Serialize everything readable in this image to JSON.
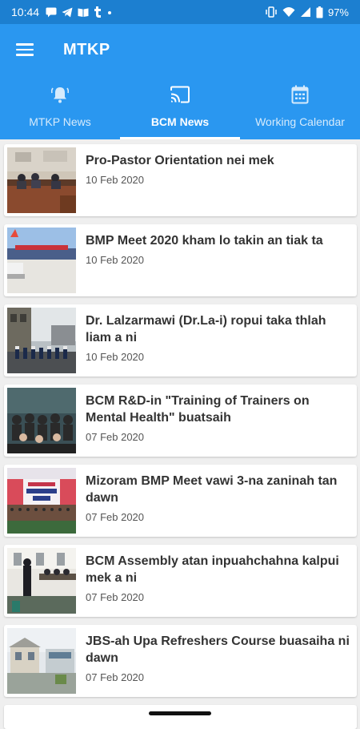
{
  "status_bar": {
    "time": "10:44",
    "battery": "97%",
    "left_icons": [
      "messages-icon",
      "telegram-icon",
      "book-icon",
      "t-app-icon",
      "dot-icon"
    ],
    "right_icons": [
      "vibrate-icon",
      "wifi-icon",
      "signal-icon",
      "battery-icon"
    ]
  },
  "app_bar": {
    "title": "MTKP",
    "menu_icon": "menu-icon",
    "background": "#2a97f0"
  },
  "tabs": [
    {
      "label": "MTKP News",
      "icon": "bell-icon",
      "active": false
    },
    {
      "label": "BCM News",
      "icon": "cast-icon",
      "active": true
    },
    {
      "label": "Working Calendar",
      "icon": "calendar-icon",
      "active": false
    }
  ],
  "news": [
    {
      "title": "Pro-Pastor Orientation nei mek",
      "date": "10 Feb 2020"
    },
    {
      "title": "BMP Meet 2020 kham lo takin an tiak ta",
      "date": "10 Feb 2020"
    },
    {
      "title": "Dr. Lalzarmawi (Dr.La-i) ropui taka thlah liam a ni",
      "date": "10 Feb 2020"
    },
    {
      "title": "BCM R&D-in \"Training of Trainers on Mental Health\" buatsaih",
      "date": "07 Feb 2020"
    },
    {
      "title": "Mizoram BMP Meet vawi 3-na zaninah tan dawn",
      "date": "07 Feb 2020"
    },
    {
      "title": "BCM Assembly atan inpuahchahna kalpui mek a ni",
      "date": "07 Feb 2020"
    },
    {
      "title": "JBS-ah Upa Refreshers Course buasaiha ni dawn",
      "date": "07 Feb 2020"
    }
  ]
}
